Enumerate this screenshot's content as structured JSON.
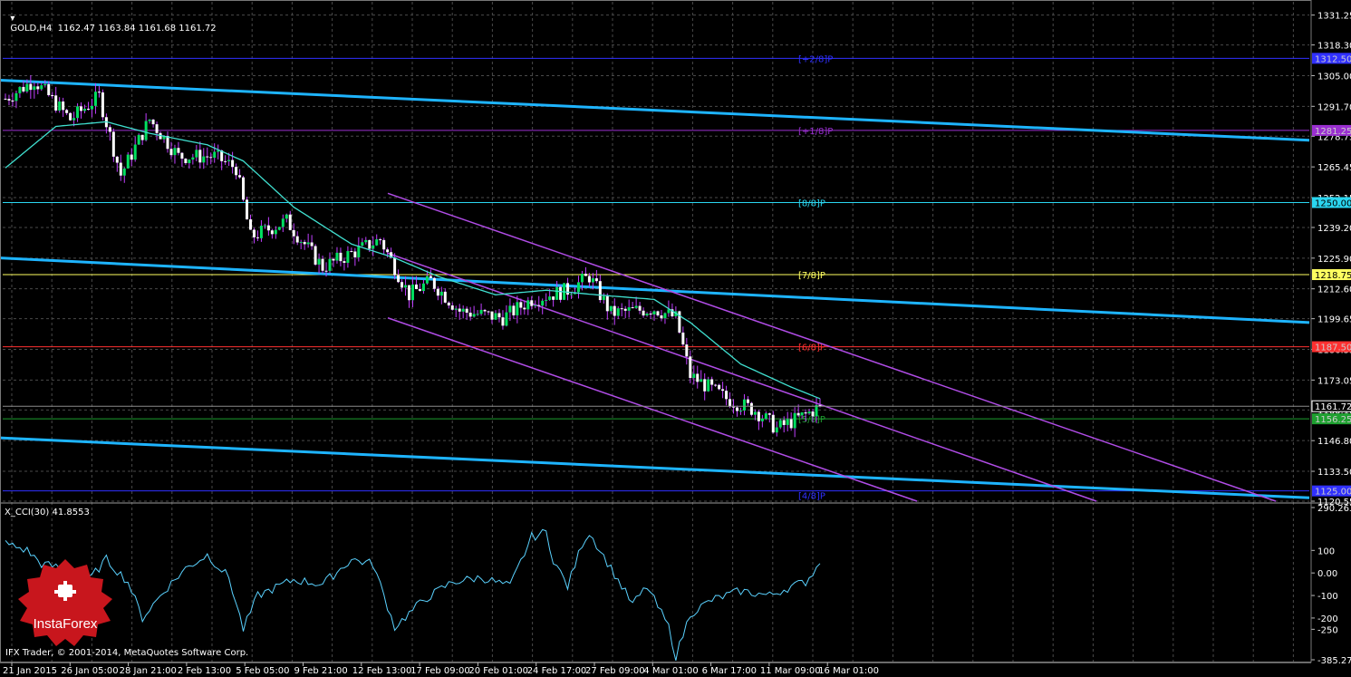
{
  "header": {
    "symbol_line": "GOLD,H4  1162.47 1163.84 1161.68 1161.72",
    "indicator_line": "X_CCI(30) 41.8553"
  },
  "footer": {
    "copyright": "IFX Trader, © 2001-2014, MetaQuotes Software Corp."
  },
  "logo": {
    "text": "InstaForex",
    "color": "#c8161d"
  },
  "colors": {
    "background": "#000000",
    "grid": "#4a4a4a",
    "bull_candle": "#00e060",
    "bear_candle": "#ffffff",
    "wick": "#c040ff",
    "ma": "#40e0d0",
    "trend": "#1eb4ff",
    "channel": "#b04ce6",
    "cci": "#5ad2ff"
  },
  "chart_data": {
    "type": "candlestick",
    "symbol": "GOLD",
    "timeframe": "H4",
    "ylim": [
      1120.55,
      1337.0
    ],
    "price_ticks": [
      "1331.25",
      "1318.30",
      "1305.00",
      "1291.70",
      "1278.75",
      "1265.45",
      "1252.15",
      "1239.20",
      "1225.90",
      "1212.60",
      "1199.65",
      "1186.35",
      "1173.05",
      "1160.10",
      "1146.80",
      "1133.50",
      "1120.55"
    ],
    "x_labels": [
      "21 Jan 2015",
      "26 Jan 05:00",
      "28 Jan 21:00",
      "2 Feb 13:00",
      "5 Feb 05:00",
      "9 Feb 21:00",
      "12 Feb 13:00",
      "17 Feb 09:00",
      "20 Feb 01:00",
      "24 Feb 17:00",
      "27 Feb 09:00",
      "4 Mar 01:00",
      "6 Mar 17:00",
      "11 Mar 09:00",
      "16 Mar 01:00"
    ],
    "price_anchors": [
      [
        0,
        1295
      ],
      [
        8,
        1303
      ],
      [
        18,
        1286
      ],
      [
        26,
        1296
      ],
      [
        32,
        1262
      ],
      [
        40,
        1286
      ],
      [
        48,
        1270
      ],
      [
        58,
        1270
      ],
      [
        64,
        1265
      ],
      [
        68,
        1235
      ],
      [
        78,
        1242
      ],
      [
        88,
        1222
      ],
      [
        96,
        1228
      ],
      [
        104,
        1234
      ],
      [
        112,
        1210
      ],
      [
        118,
        1216
      ],
      [
        126,
        1203
      ],
      [
        138,
        1200
      ],
      [
        146,
        1208
      ],
      [
        156,
        1212
      ],
      [
        162,
        1218
      ],
      [
        168,
        1202
      ],
      [
        180,
        1204
      ],
      [
        186,
        1200
      ],
      [
        190,
        1175
      ],
      [
        200,
        1165
      ],
      [
        208,
        1160
      ],
      [
        214,
        1152
      ],
      [
        222,
        1158
      ],
      [
        226,
        1161.72
      ]
    ],
    "ma_anchors": [
      [
        0,
        1265
      ],
      [
        14,
        1283
      ],
      [
        28,
        1285
      ],
      [
        40,
        1280
      ],
      [
        56,
        1275
      ],
      [
        66,
        1268
      ],
      [
        80,
        1248
      ],
      [
        96,
        1232
      ],
      [
        108,
        1226
      ],
      [
        120,
        1218
      ],
      [
        136,
        1210
      ],
      [
        150,
        1212
      ],
      [
        164,
        1210
      ],
      [
        180,
        1208
      ],
      [
        190,
        1198
      ],
      [
        204,
        1180
      ],
      [
        218,
        1170
      ],
      [
        226,
        1165
      ]
    ],
    "horizontal_levels": [
      {
        "label": "[+2/8]P",
        "price": 1312.5,
        "color": "#3030ff",
        "tag": "1312.50"
      },
      {
        "label": "[+1/8]P",
        "price": 1281.25,
        "color": "#9a2fd0",
        "tag": "1281.25"
      },
      {
        "label": "[8/8]P",
        "price": 1250.0,
        "color": "#2ad6f0",
        "tag": "1250.00"
      },
      {
        "label": "[7/8]P",
        "price": 1218.75,
        "color": "#ffff60",
        "tag": "1218.75"
      },
      {
        "label": "[6/8]P",
        "price": 1187.5,
        "color": "#ff3030",
        "tag": "1187.50"
      },
      {
        "label": "[5/8]P",
        "price": 1156.25,
        "color": "#1ea030",
        "tag": "1156.25"
      },
      {
        "label": "[4/8]P",
        "price": 1125.0,
        "color": "#3030ff",
        "tag": "1125.00"
      }
    ],
    "current_price": {
      "value": 1161.72,
      "tag": "1161.72"
    },
    "trend_lines": [
      {
        "from": [
          0,
          1303
        ],
        "to": [
          1445,
          1277
        ]
      },
      {
        "from": [
          0,
          1226
        ],
        "to": [
          1445,
          1198
        ]
      },
      {
        "from": [
          0,
          1148
        ],
        "to": [
          1445,
          1122
        ]
      }
    ],
    "channel_lines": [
      {
        "from": [
          428,
          1254
        ],
        "to": [
          1408,
          1120.55
        ]
      },
      {
        "from": [
          428,
          1228
        ],
        "to": [
          1210,
          1120.55
        ]
      },
      {
        "from": [
          428,
          1200
        ],
        "to": [
          1012,
          1120.55
        ]
      }
    ],
    "cci": {
      "name": "X_CCI(30)",
      "last": 41.8553,
      "ylim": [
        -385.27,
        290.26
      ],
      "ticks": [
        "290.263",
        "100",
        "0.00",
        "-100",
        "-200",
        "-250",
        "-385.2709"
      ],
      "anchors": [
        [
          0,
          130
        ],
        [
          6,
          100
        ],
        [
          10,
          40
        ],
        [
          16,
          20
        ],
        [
          20,
          -90
        ],
        [
          28,
          60
        ],
        [
          34,
          -40
        ],
        [
          38,
          -200
        ],
        [
          44,
          -80
        ],
        [
          50,
          20
        ],
        [
          56,
          80
        ],
        [
          62,
          -20
        ],
        [
          66,
          -250
        ],
        [
          70,
          -100
        ],
        [
          80,
          -30
        ],
        [
          88,
          -50
        ],
        [
          96,
          60
        ],
        [
          102,
          40
        ],
        [
          108,
          -240
        ],
        [
          116,
          -120
        ],
        [
          124,
          -40
        ],
        [
          132,
          -20
        ],
        [
          140,
          -60
        ],
        [
          146,
          160
        ],
        [
          150,
          180
        ],
        [
          152,
          60
        ],
        [
          156,
          -60
        ],
        [
          160,
          130
        ],
        [
          162,
          180
        ],
        [
          168,
          20
        ],
        [
          174,
          -140
        ],
        [
          178,
          -60
        ],
        [
          184,
          -240
        ],
        [
          186,
          -370
        ],
        [
          190,
          -180
        ],
        [
          196,
          -120
        ],
        [
          204,
          -80
        ],
        [
          212,
          -100
        ],
        [
          218,
          -60
        ],
        [
          222,
          -40
        ],
        [
          226,
          41.8553
        ]
      ]
    }
  }
}
